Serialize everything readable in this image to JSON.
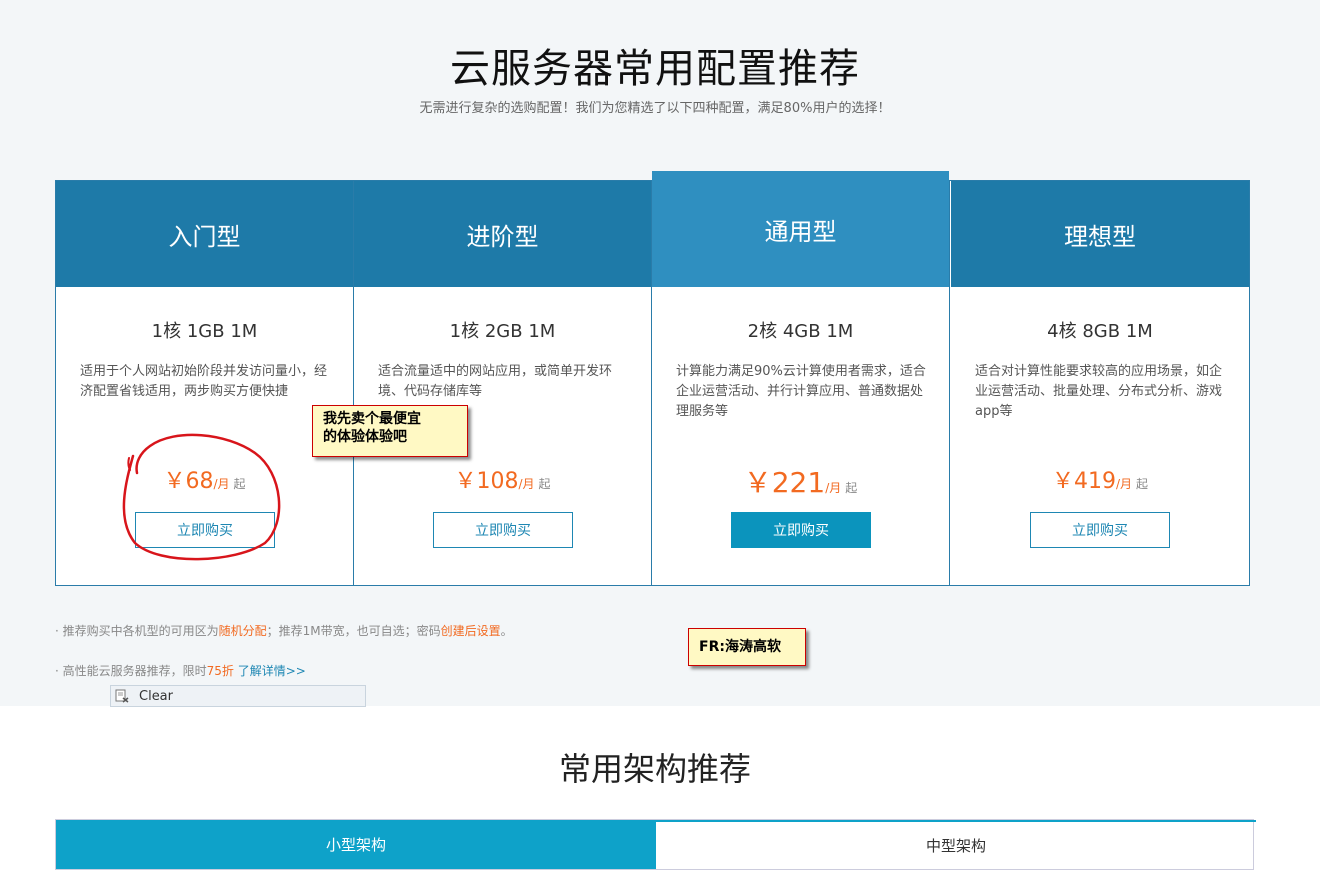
{
  "header": {
    "title": "云服务器常用配置推荐",
    "subtitle": "无需进行复杂的选购配置！我们为您精选了以下四种配置，满足80%用户的选择！"
  },
  "plans": [
    {
      "name": "入门型",
      "spec": "1核 1GB 1M",
      "desc": "适用于个人网站初始阶段并发访问量小，经济配置省钱适用，两步购买方便快捷",
      "price": "￥68",
      "unit": "/月",
      "start": "起",
      "button": "立即购买"
    },
    {
      "name": "进阶型",
      "spec": "1核 2GB 1M",
      "desc": "适合流量适中的网站应用，或简单开发环境、代码存储库等",
      "price": "￥108",
      "unit": "/月",
      "start": "起",
      "button": "立即购买"
    },
    {
      "name": "通用型",
      "spec": "2核 4GB 1M",
      "desc": "计算能力满足90%云计算使用者需求，适合企业运营活动、并行计算应用、普通数据处理服务等",
      "price": "￥221",
      "unit": "/月",
      "start": "起",
      "button": "立即购买"
    },
    {
      "name": "理想型",
      "spec": "4核 8GB 1M",
      "desc": "适合对计算性能要求较高的应用场景，如企业运营活动、批量处理、分布式分析、游戏app等",
      "price": "￥419",
      "unit": "/月",
      "start": "起",
      "button": "立即购买"
    }
  ],
  "notes": {
    "n1_prefix": "· 推荐购买中各机型的可用区为",
    "n1_hl1": "随机分配",
    "n1_mid": "；推荐1M带宽，也可自选；密码",
    "n1_hl2": "创建后设置",
    "n1_end": "。",
    "n2_prefix": "· 高性能云服务器推荐，限时",
    "n2_hl": "75折",
    "n2_link": "了解详情>>"
  },
  "annotations": {
    "callout1_line1": "我先卖个最便宜",
    "callout1_line2": "的体验体验吧",
    "callout2": "FR:海涛高软"
  },
  "clear_bar": {
    "label": "Clear"
  },
  "section2": {
    "title": "常用架构推荐"
  },
  "tabs": [
    {
      "label": "小型架构"
    },
    {
      "label": "中型架构"
    }
  ],
  "colors": {
    "primary": "#1e7aa8",
    "featured": "#2f8fc0",
    "accent": "#f26a21",
    "tab_active": "#0ea2c9"
  }
}
